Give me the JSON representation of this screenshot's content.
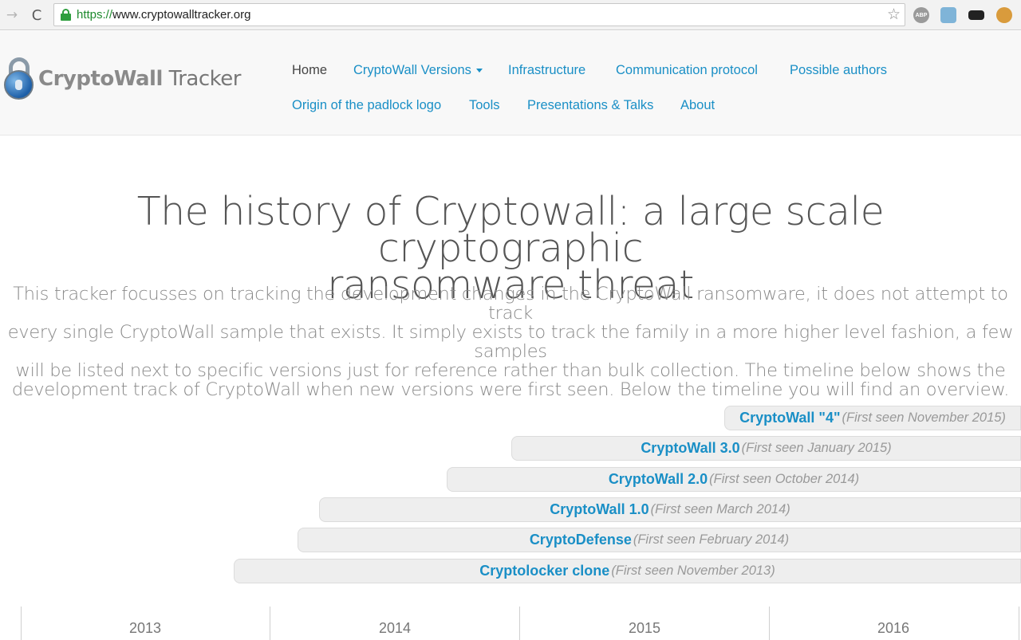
{
  "browser": {
    "url_scheme": "https://",
    "url_rest": "www.cryptowalltracker.org",
    "back_glyph": "→",
    "reload_glyph": "C",
    "star_glyph": "☆",
    "extensions": [
      {
        "icon": "adblock-icon",
        "label": "ABP"
      },
      {
        "icon": "camera-icon",
        "label": ""
      },
      {
        "icon": "mask-icon",
        "label": ""
      },
      {
        "icon": "cookie-icon",
        "label": ""
      }
    ]
  },
  "header": {
    "logo_bold": "CryptoWall",
    "logo_light": " Tracker",
    "nav": [
      {
        "label": "Home",
        "active": true
      },
      {
        "label": "CryptoWall Versions",
        "dropdown": true
      },
      {
        "label": "Infrastructure"
      },
      {
        "label": "Communication protocol"
      },
      {
        "label": "Possible authors"
      },
      {
        "label": "Origin of the padlock logo"
      },
      {
        "label": "Tools"
      },
      {
        "label": "Presentations & Talks"
      },
      {
        "label": "About"
      }
    ]
  },
  "hero": {
    "title_line1": "The history of Cryptowall: a large scale cryptographic",
    "title_line2": "ransomware threat",
    "desc_line1": "This tracker focusses on tracking the development changes in the CryptoWall ransomware, it does not attempt to track",
    "desc_line2": "every single CryptoWall sample that exists. It simply exists to track the family in a more higher level fashion, a few samples",
    "desc_line3": "will be listed next to specific versions just for reference rather than bulk collection. The timeline below shows the",
    "desc_line4": "development track of CryptoWall when new versions were first seen. Below the timeline you will find an overview."
  },
  "timeline": {
    "entries": [
      {
        "name": "CryptoWall \"4\"",
        "seen": "(First seen November 2015)"
      },
      {
        "name": "CryptoWall 3.0",
        "seen": "(First seen January 2015)"
      },
      {
        "name": "CryptoWall 2.0",
        "seen": "(First seen October 2014)"
      },
      {
        "name": "CryptoWall 1.0",
        "seen": "(First seen March 2014)"
      },
      {
        "name": "CryptoDefense",
        "seen": "(First seen February 2014)"
      },
      {
        "name": "Cryptolocker clone",
        "seen": " (First seen November 2013)"
      }
    ],
    "years": [
      "2013",
      "2014",
      "2015",
      "2016"
    ]
  },
  "colors": {
    "link": "#1a8fc6",
    "header_bg": "#f8f8f8",
    "bar_bg": "#eeeeee"
  }
}
